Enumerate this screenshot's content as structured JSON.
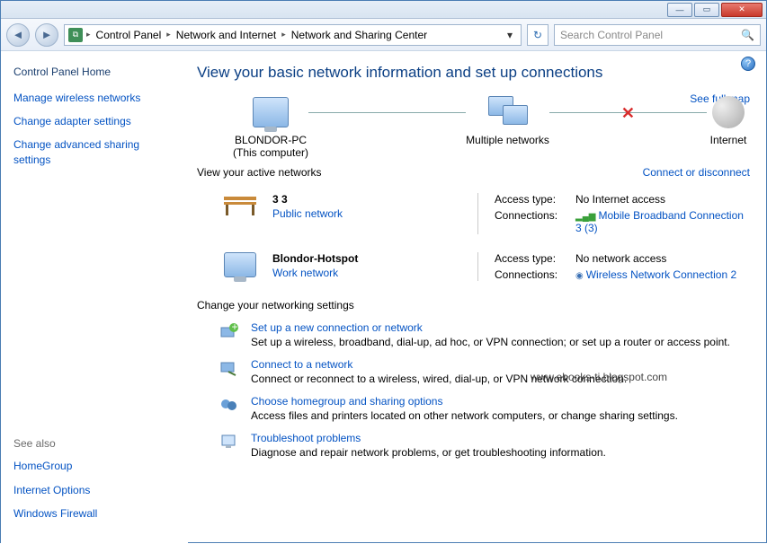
{
  "window": {
    "minimize": "—",
    "maximize": "▭",
    "close": "✕"
  },
  "nav": {
    "back": "◄",
    "forward": "►",
    "refresh": "↻",
    "dropdown": "▾"
  },
  "breadcrumbs": [
    "Control Panel",
    "Network and Internet",
    "Network and Sharing Center"
  ],
  "search": {
    "placeholder": "Search Control Panel"
  },
  "sidebar": {
    "home": "Control Panel Home",
    "links": [
      "Manage wireless networks",
      "Change adapter settings",
      "Change advanced sharing settings"
    ],
    "seealso_label": "See also",
    "seealso": [
      "HomeGroup",
      "Internet Options",
      "Windows Firewall"
    ]
  },
  "help_icon": "?",
  "page_title": "View your basic network information and set up connections",
  "full_map": "See full map",
  "diagram": {
    "node1_name": "BLONDOR-PC",
    "node1_sub": "(This computer)",
    "node2_name": "Multiple networks",
    "node3_name": "Internet",
    "xmark": "✕"
  },
  "active_label": "View your active networks",
  "connect_link": "Connect or disconnect",
  "net1": {
    "name": "3  3",
    "type": "Public network",
    "access_k": "Access type:",
    "access_v": "No Internet access",
    "conn_k": "Connections:",
    "conn_v": "Mobile Broadband Connection 3 (3)"
  },
  "net2": {
    "name": "Blondor-Hotspot",
    "type": "Work network",
    "access_k": "Access type:",
    "access_v": "No network access",
    "conn_k": "Connections:",
    "conn_v": "Wireless Network Connection 2"
  },
  "change_label": "Change your networking settings",
  "watermark": "www.ebooks-ti.blogspot.com",
  "tasks": [
    {
      "title": "Set up a new connection or network",
      "desc": "Set up a wireless, broadband, dial-up, ad hoc, or VPN connection; or set up a router or access point."
    },
    {
      "title": "Connect to a network",
      "desc": "Connect or reconnect to a wireless, wired, dial-up, or VPN network connection."
    },
    {
      "title": "Choose homegroup and sharing options",
      "desc": "Access files and printers located on other network computers, or change sharing settings."
    },
    {
      "title": "Troubleshoot problems",
      "desc": "Diagnose and repair network problems, or get troubleshooting information."
    }
  ]
}
